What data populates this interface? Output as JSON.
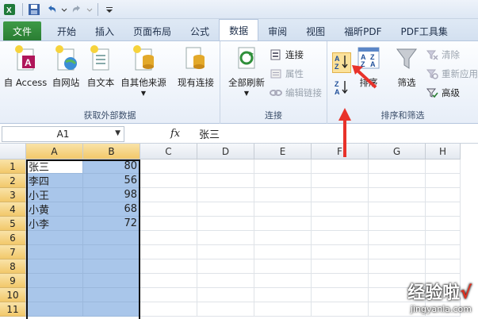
{
  "quick_access": {
    "app_icon": "excel-icon",
    "items": [
      "save-icon",
      "undo-icon",
      "redo-icon",
      "customize-icon"
    ]
  },
  "tabs": [
    {
      "label": "文件",
      "active": false
    },
    {
      "label": "开始",
      "active": false
    },
    {
      "label": "插入",
      "active": false
    },
    {
      "label": "页面布局",
      "active": false
    },
    {
      "label": "公式",
      "active": false
    },
    {
      "label": "数据",
      "active": true
    },
    {
      "label": "审阅",
      "active": false
    },
    {
      "label": "视图",
      "active": false
    },
    {
      "label": "福昕PDF",
      "active": false
    },
    {
      "label": "PDF工具集",
      "active": false
    }
  ],
  "ribbon": {
    "get_external": {
      "label": "获取外部数据",
      "from_access": "自 Access",
      "from_web": "自网站",
      "from_text": "自文本",
      "from_other": "自其他来源",
      "existing": "现有连接"
    },
    "connections": {
      "label": "连接",
      "refresh_all": "全部刷新",
      "connections": "连接",
      "properties": "属性",
      "edit_links": "编辑链接"
    },
    "sort_filter": {
      "label": "排序和筛选",
      "sort": "排序",
      "filter": "筛选",
      "clear": "清除",
      "reapply": "重新应用",
      "advanced": "高级"
    }
  },
  "formula_bar": {
    "name_box": "A1",
    "fx": "fx",
    "value": "张三"
  },
  "grid": {
    "columns": [
      "A",
      "B",
      "C",
      "D",
      "E",
      "F",
      "G",
      "H"
    ],
    "rows": [
      "1",
      "2",
      "3",
      "4",
      "5",
      "6",
      "7",
      "8",
      "9",
      "10",
      "11"
    ],
    "data": [
      [
        "张三",
        "80"
      ],
      [
        "李四",
        "56"
      ],
      [
        "小王",
        "98"
      ],
      [
        "小黄",
        "68"
      ],
      [
        "小李",
        "72"
      ]
    ]
  },
  "watermark": {
    "cn": "经验啦",
    "check": "√",
    "en": "jingyanla.com"
  },
  "colors": {
    "accent_file_tab": "#2a7d33",
    "selection": "#a9c6ea",
    "header_selected": "#f2c86a",
    "annotation_arrow": "#e8322a"
  }
}
